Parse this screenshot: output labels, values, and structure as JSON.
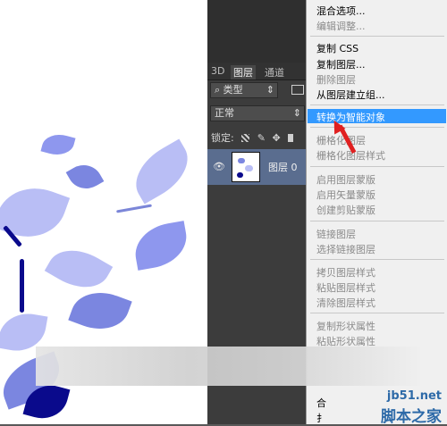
{
  "panel": {
    "tabs": [
      "3D",
      "图层",
      "通道"
    ],
    "kind_filter": "类型",
    "blend_mode": "正常",
    "lock_label": "锁定:",
    "layer_name": "图层 0"
  },
  "menu": {
    "items": [
      {
        "label": "混合选项...",
        "enabled": true
      },
      {
        "label": "编辑调整...",
        "enabled": false
      },
      {
        "label": "复制 CSS",
        "enabled": true
      },
      {
        "label": "复制图层...",
        "enabled": true
      },
      {
        "label": "删除图层",
        "enabled": false
      },
      {
        "label": "从图层建立组...",
        "enabled": true
      },
      {
        "label": "转换为智能对象",
        "enabled": true,
        "selected": true
      },
      {
        "label": "栅格化图层",
        "enabled": false
      },
      {
        "label": "栅格化图层样式",
        "enabled": false
      },
      {
        "label": "启用图层蒙版",
        "enabled": false
      },
      {
        "label": "启用矢量蒙版",
        "enabled": false
      },
      {
        "label": "创建剪贴蒙版",
        "enabled": false
      },
      {
        "label": "链接图层",
        "enabled": false
      },
      {
        "label": "选择链接图层",
        "enabled": false
      },
      {
        "label": "拷贝图层样式",
        "enabled": false
      },
      {
        "label": "粘贴图层样式",
        "enabled": false
      },
      {
        "label": "清除图层样式",
        "enabled": false
      },
      {
        "label": "复制形状属性",
        "enabled": false
      },
      {
        "label": "粘贴形状属性",
        "enabled": false
      },
      {
        "label": "合",
        "enabled": true
      },
      {
        "label": "扌",
        "enabled": true
      }
    ]
  },
  "watermark": {
    "site": "jb51.net",
    "name": "脚本之家"
  },
  "colors": {
    "leaf": "#b9bef5",
    "leaf_dark": "#7b86e0",
    "stem_dark": "#0a0a8c",
    "highlight": "#3399ff",
    "annotation_arrow": "#e02020"
  }
}
